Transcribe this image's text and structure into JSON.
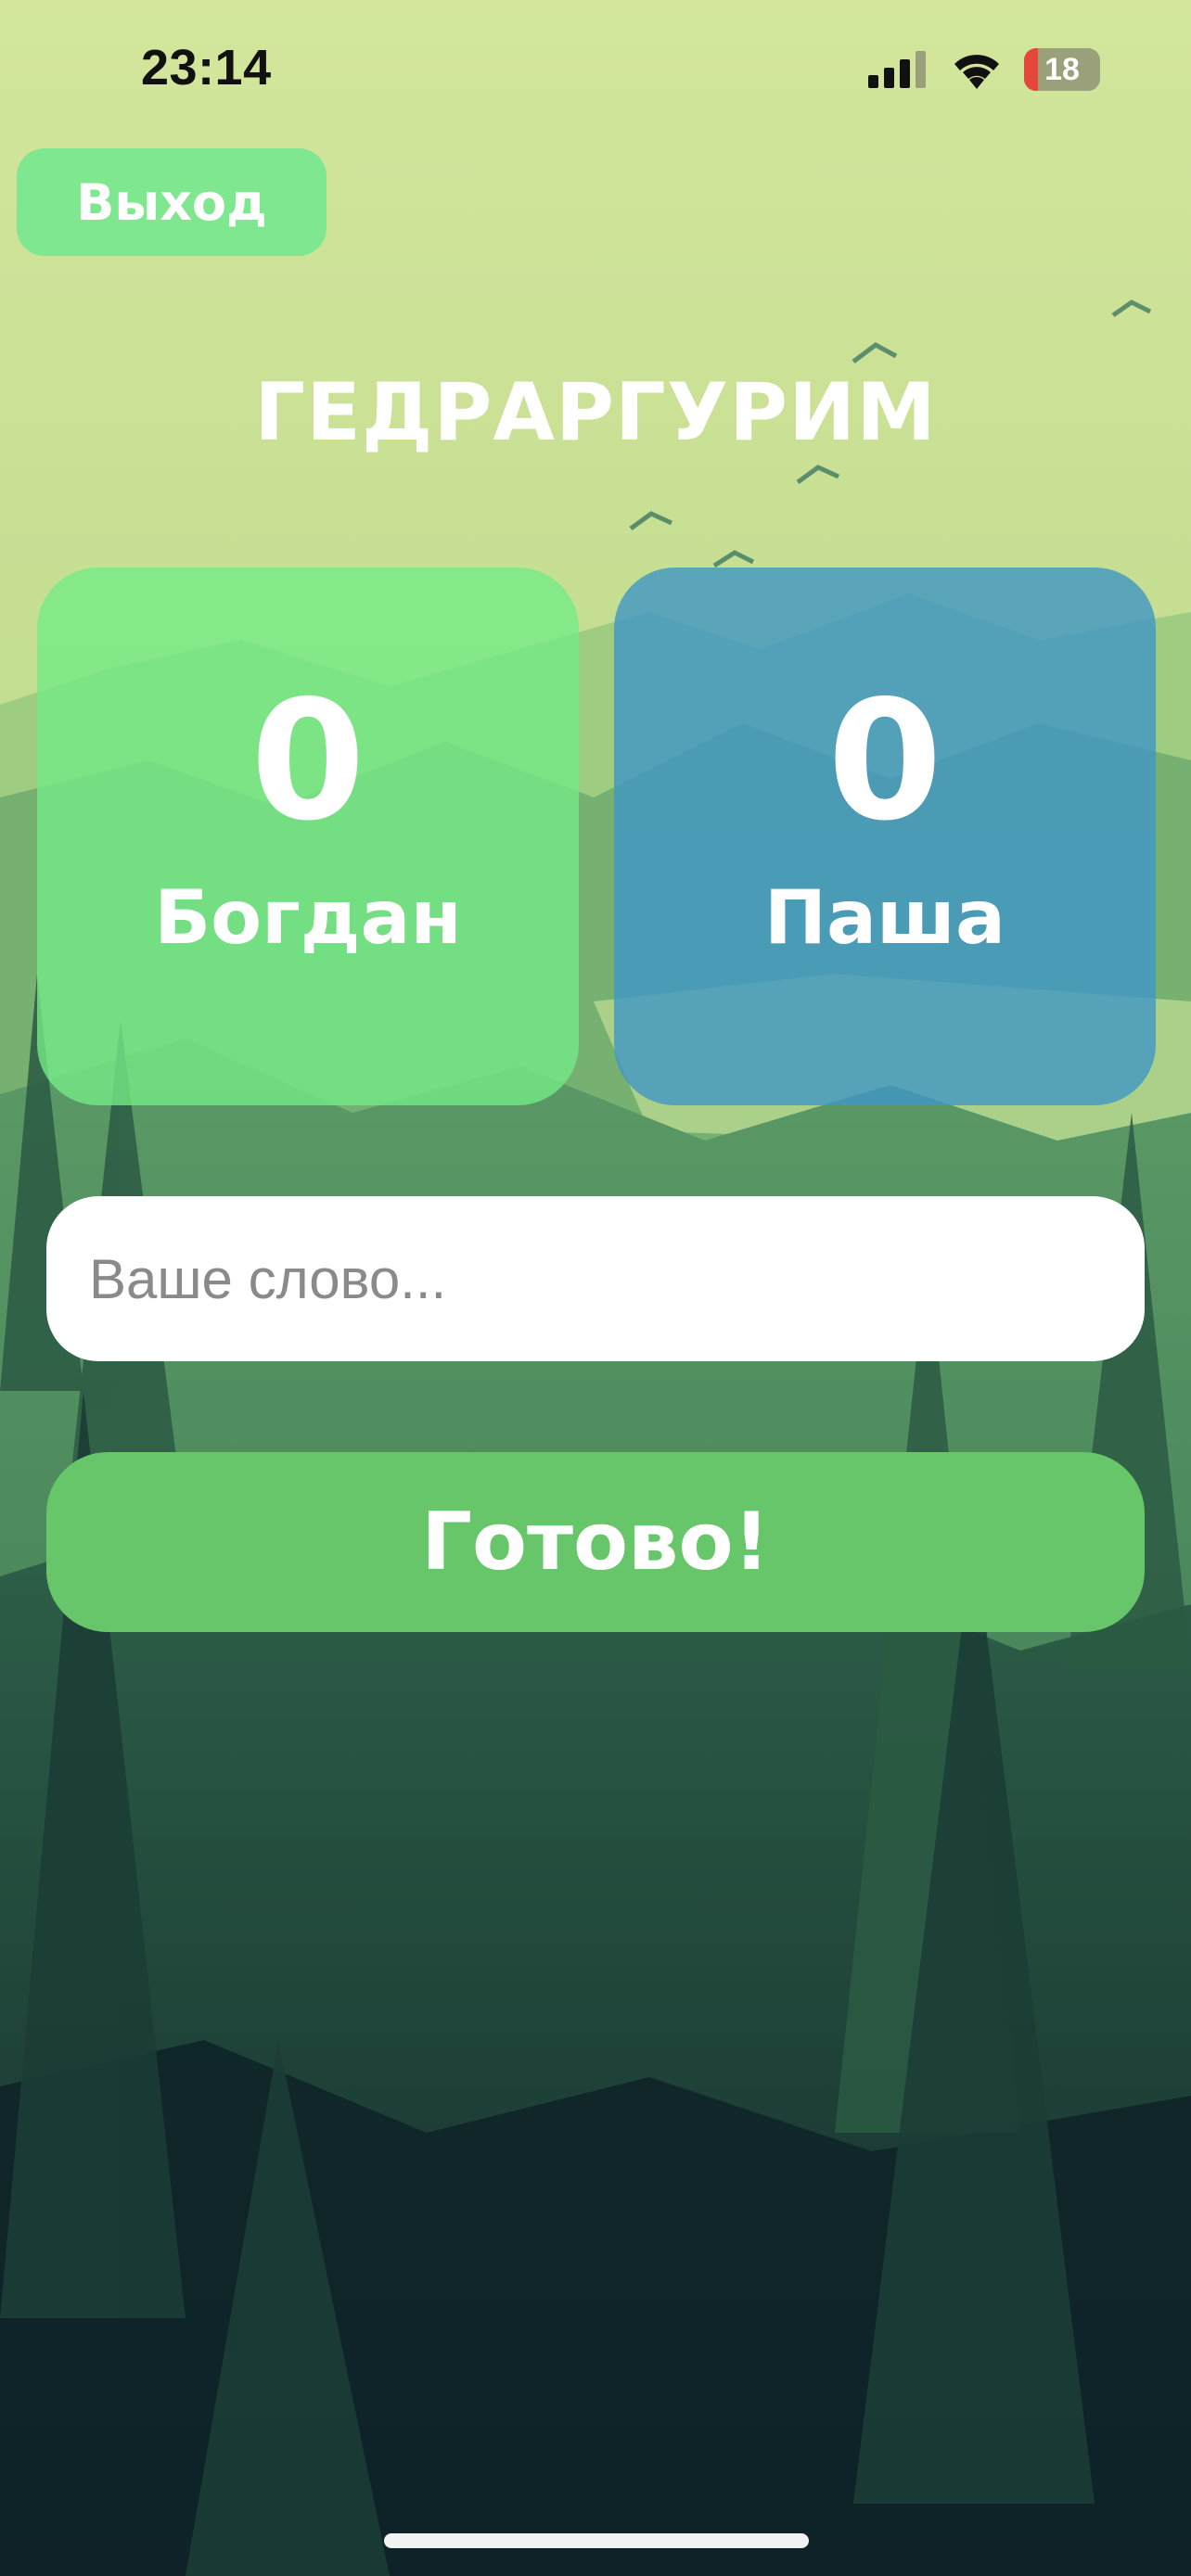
{
  "status_bar": {
    "time": "23:14",
    "battery_percent": 18,
    "battery_label": "18",
    "signal_icon": "cellular-signal-icon",
    "wifi_icon": "wifi-icon",
    "battery_icon": "battery-charging-icon"
  },
  "header": {
    "exit_label": "Выход"
  },
  "game": {
    "word": "ГЕДРАРГУРИМ",
    "players": [
      {
        "name": "Богдан",
        "score": "0",
        "color": "#74ea87"
      },
      {
        "name": "Паша",
        "score": "0",
        "color": "#4096c6"
      }
    ]
  },
  "input": {
    "value": "",
    "placeholder": "Ваше слово..."
  },
  "actions": {
    "ready_label": "Готово!"
  },
  "colors": {
    "exit_button": "#7fe78f",
    "ready_button": "#68c66a",
    "background_top": "#cfe49a",
    "background_bottom": "#12282b"
  }
}
